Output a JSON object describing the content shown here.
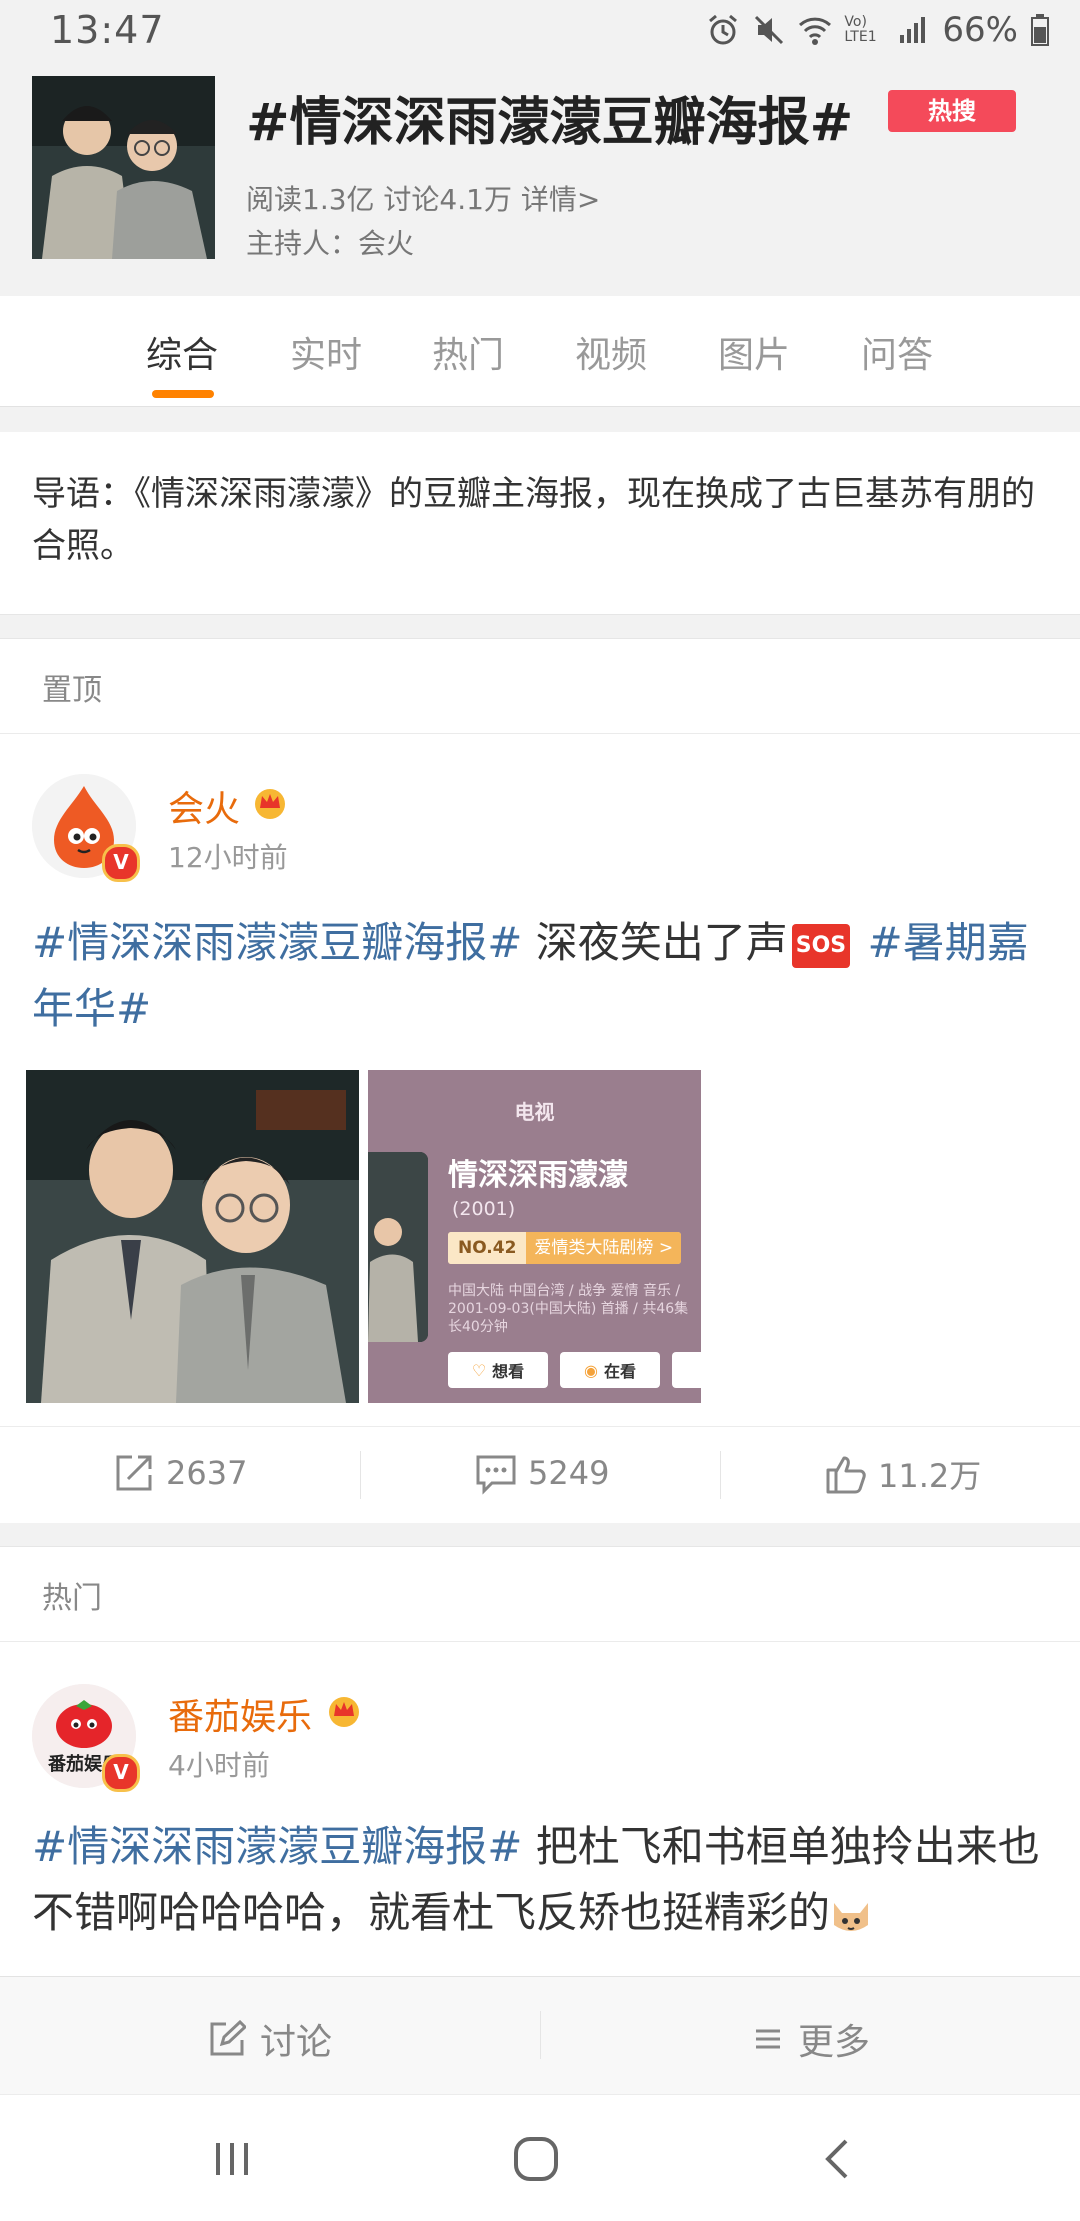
{
  "status_bar": {
    "time": "13:47",
    "battery": "66%",
    "network": "Vo) LTE1"
  },
  "header": {
    "title": "#情深深雨濛濛豆瓣海报#",
    "hot_badge": "热搜",
    "stats": "阅读1.3亿  讨论4.1万  详情>",
    "host": "主持人：会火"
  },
  "tabs": [
    {
      "label": "综合",
      "active": true
    },
    {
      "label": "实时",
      "active": false
    },
    {
      "label": "热门",
      "active": false
    },
    {
      "label": "视频",
      "active": false
    },
    {
      "label": "图片",
      "active": false
    },
    {
      "label": "问答",
      "active": false
    }
  ],
  "intro": {
    "text": "导语：《情深深雨濛濛》的豆瓣主海报，现在换成了古巨基苏有朋的合照。"
  },
  "pinned_section": {
    "label": "置顶",
    "post": {
      "username": "会火",
      "time": "12小时前",
      "tag1": "#情深深雨濛濛豆瓣海报#",
      "text": " 深夜笑出了声",
      "emoji": "SOS",
      "tag2": " #暑期嘉年华#",
      "image2": {
        "category": "电视",
        "title": "情深深雨濛濛",
        "year": "(2001)",
        "rank_no": "NO.42",
        "rank_label": "爱情类大陆剧榜 >",
        "meta_line1": "中国大陆 中国台湾 / 战争 爱情 音乐 /",
        "meta_line2": "2001-09-03(中国大陆) 首播 / 共46集",
        "meta_line3": "长40分钟",
        "btn_want": "想看",
        "btn_watching": "在看"
      },
      "reposts": "2637",
      "comments": "5249",
      "likes": "11.2万"
    }
  },
  "hot_section": {
    "label": "热门",
    "post": {
      "username": "番茄娱乐",
      "time": "4小时前",
      "avatar_text": "番茄娱乐",
      "tag1": "#情深深雨濛濛豆瓣海报#",
      "text": " 把杜飞和书桓单独拎出来也不错啊哈哈哈哈，就看杜飞反矫也挺精彩的"
    }
  },
  "bottom_bar": {
    "discuss": "讨论",
    "more": "更多"
  },
  "colors": {
    "accent_orange": "#ff8200",
    "username_orange": "#e86b0c",
    "link_blue": "#3f6ea0",
    "hot_red": "#f44a5a"
  }
}
